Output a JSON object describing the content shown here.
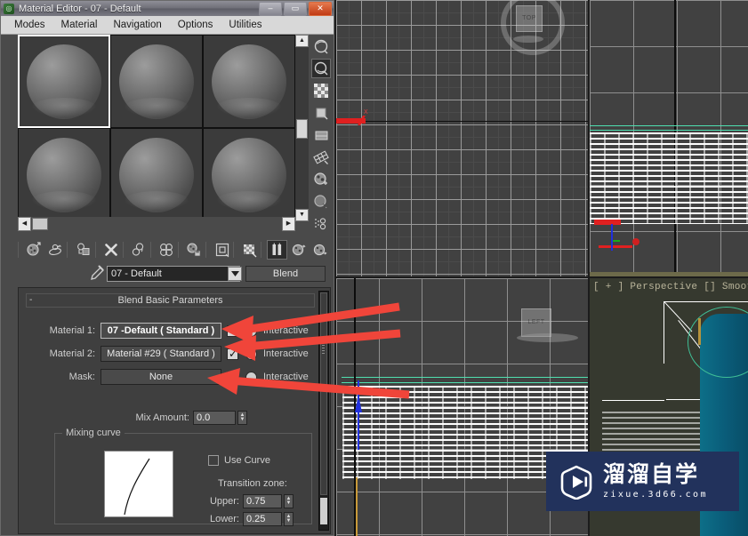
{
  "window": {
    "title": "Material Editor - 07 - Default",
    "app_icon": "material-editor-icon",
    "buttons": {
      "minimize": "–",
      "maximize": "▭",
      "close": "✕"
    }
  },
  "menubar": {
    "items": [
      "Modes",
      "Material",
      "Navigation",
      "Options",
      "Utilities"
    ]
  },
  "slots": {
    "count": 6,
    "selected_index": 0,
    "items": [
      {
        "name": "slot-1",
        "selected": true
      },
      {
        "name": "slot-2",
        "selected": false
      },
      {
        "name": "slot-3",
        "selected": false
      },
      {
        "name": "slot-4",
        "selected": false
      },
      {
        "name": "slot-5",
        "selected": false
      },
      {
        "name": "slot-6",
        "selected": false
      }
    ]
  },
  "vertical_toolbar": {
    "items": [
      {
        "icon": "sample-type-sphere-icon",
        "active": false
      },
      {
        "icon": "backlight-icon",
        "active": true
      },
      {
        "icon": "background-checker-icon",
        "active": false
      },
      {
        "icon": "sample-uv-tiling-icon",
        "active": false
      },
      {
        "icon": "video-color-check-icon",
        "active": false
      },
      {
        "icon": "make-preview-icon",
        "active": false
      },
      {
        "icon": "options-icon",
        "active": false
      },
      {
        "icon": "select-by-material-icon",
        "active": false
      },
      {
        "icon": "material-id-channel-icon",
        "active": false
      }
    ]
  },
  "horizontal_toolbar": {
    "items": [
      {
        "icon": "get-material-icon",
        "active": false
      },
      {
        "icon": "put-material-to-scene-icon",
        "active": false
      },
      {
        "icon": "assign-material-to-selection-icon",
        "active": false
      },
      {
        "icon": "reset-map-material-icon",
        "active": false
      },
      {
        "icon": "make-material-copy-icon",
        "active": false
      },
      {
        "icon": "make-unique-icon",
        "active": false
      },
      {
        "icon": "put-to-library-icon",
        "active": false
      },
      {
        "icon": "material-effects-channel-icon",
        "active": false
      },
      {
        "icon": "show-shaded-material-in-viewport-icon",
        "active": false
      },
      {
        "icon": "show-end-result-icon",
        "active": true
      },
      {
        "icon": "go-to-parent-icon",
        "active": false
      },
      {
        "icon": "go-forward-to-sibling-icon",
        "active": false
      }
    ]
  },
  "name_row": {
    "eyedropper_icon": "eyedropper-icon",
    "material_name": "07 - Default",
    "dropdown_icon": "chevron-down-icon",
    "material_type_button": "Blend"
  },
  "params": {
    "rollout_title": "Blend Basic Parameters",
    "collapse_glyph": "-",
    "rows": [
      {
        "label": "Material 1:",
        "value": "07 -Default  ( Standard )",
        "checkbox_checked": true,
        "radio_selected": true,
        "interactive_label": "Interactive",
        "highlighted": true
      },
      {
        "label": "Material 2:",
        "value": "Material #29  ( Standard )",
        "checkbox_checked": true,
        "radio_selected": false,
        "interactive_label": "Interactive",
        "highlighted": false
      },
      {
        "label": "Mask:",
        "value": "None",
        "checkbox_checked": true,
        "radio_selected": false,
        "interactive_label": "Interactive",
        "highlighted": false
      }
    ],
    "mix_amount": {
      "label": "Mix Amount:",
      "value": "0.0"
    },
    "mixing_curve": {
      "group_title": "Mixing curve",
      "use_curve_label": "Use Curve",
      "use_curve_checked": false,
      "transition_zone_label": "Transition zone:",
      "upper": {
        "label": "Upper:",
        "value": "0.75"
      },
      "lower": {
        "label": "Lower:",
        "value": "0.25"
      }
    }
  },
  "viewports": {
    "perspective_label": "[ + ] Perspective [] Smooth + Hi",
    "viewcube_top": "TOP",
    "viewcube_left": "LEFT"
  },
  "watermark": {
    "chinese": "溜溜自学",
    "english": "zixue.3d66.com",
    "play_icon": "play-badge-icon"
  },
  "colors": {
    "annotation_arrow": "#f0453a",
    "watermark_bg": "#22325c",
    "window_chrome": "#d8d8d8",
    "panel_bg": "#3f3f3f",
    "close_button": "#c03a14",
    "viewport_teal": "#4fe0b0",
    "perspective_bg": "#36392f"
  }
}
